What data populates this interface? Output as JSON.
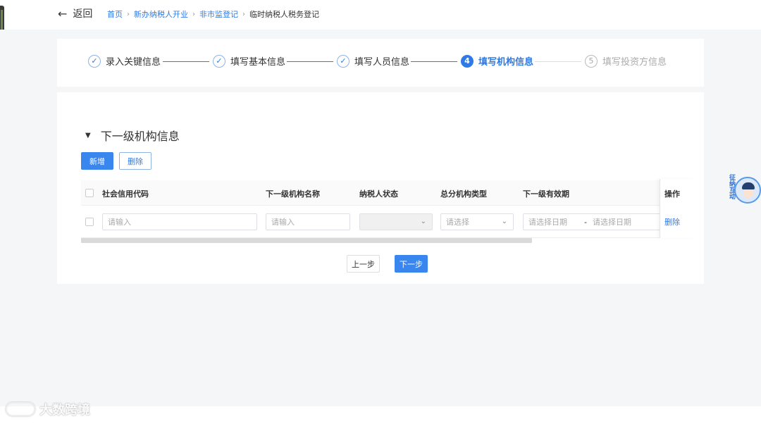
{
  "header": {
    "back_label": "返回",
    "breadcrumb": [
      {
        "label": "首页",
        "link": true
      },
      {
        "label": "新办纳税人开业",
        "link": true
      },
      {
        "label": "非市监登记",
        "link": true
      },
      {
        "label": "临时纳税人税务登记",
        "link": false
      }
    ]
  },
  "steps": [
    {
      "index": "✓",
      "label": "录入关键信息",
      "state": "done"
    },
    {
      "index": "✓",
      "label": "填写基本信息",
      "state": "done"
    },
    {
      "index": "✓",
      "label": "填写人员信息",
      "state": "done"
    },
    {
      "index": "4",
      "label": "填写机构信息",
      "state": "active"
    },
    {
      "index": "5",
      "label": "填写投资方信息",
      "state": "pending"
    }
  ],
  "section": {
    "title": "下一级机构信息",
    "add_button": "新增",
    "delete_button": "删除"
  },
  "table": {
    "columns": [
      "社会信用代码",
      "下一级机构名称",
      "纳税人状态",
      "总分机构类型",
      "下一级有效期",
      "操作"
    ],
    "row": {
      "credit_code_placeholder": "请输入",
      "name_placeholder": "请输入",
      "status_value": "",
      "type_placeholder": "请选择",
      "start_date_placeholder": "请选择日期",
      "date_separator": "-",
      "end_date_placeholder": "请选择日期",
      "row_delete": "删除"
    }
  },
  "nav": {
    "prev_button": "上一步",
    "next_button": "下一步"
  },
  "helper_widget": {
    "text": "征纳互动"
  },
  "watermark": {
    "text": "大数跨境"
  },
  "colors": {
    "accent": "#2f7ae5",
    "primary_button": "#3a86ef",
    "page_bg": "#f5f6f8"
  }
}
